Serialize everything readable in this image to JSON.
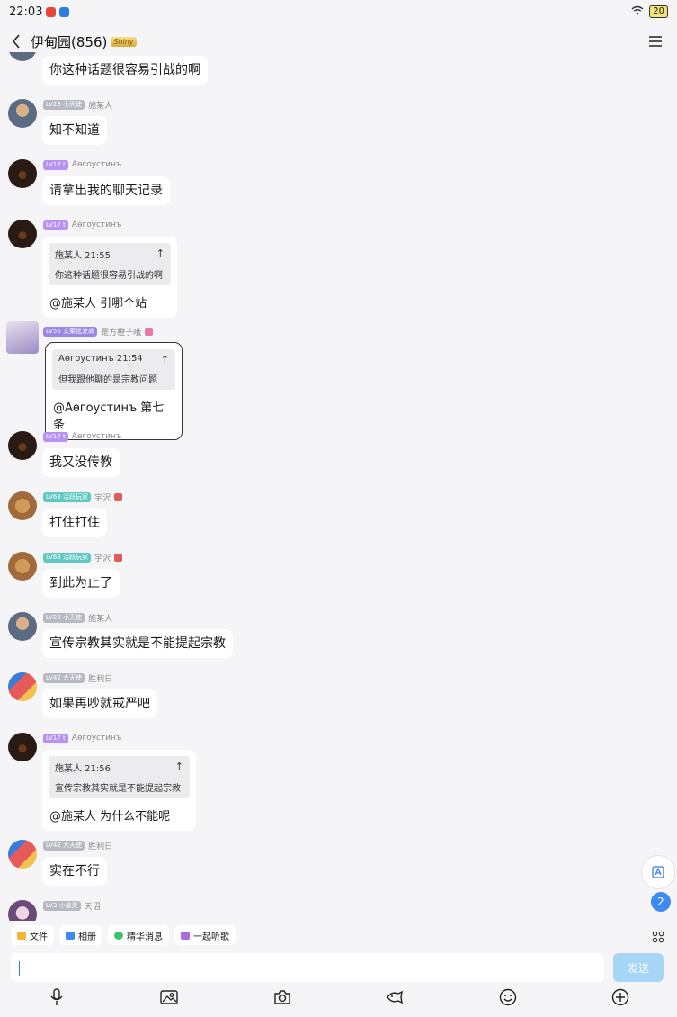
{
  "status_bar": {
    "time": "22:03",
    "battery": "20"
  },
  "header": {
    "title": "伊甸园(856)",
    "badge": "Shiny"
  },
  "messages": [
    {
      "text": "你这种话题很容易引战的啊"
    },
    {
      "level": "LV23 小天使",
      "name": "施某人",
      "text": "知不知道"
    },
    {
      "level": "LV17 t",
      "name": "Аөгоустинъ",
      "text": "请拿出我的聊天记录"
    },
    {
      "level": "LV17 t",
      "name": "Аөгоустинъ",
      "quote_head": "施某人 21:55",
      "quote_text": "你这种话题很容易引战的啊",
      "reply": "@施某人 引哪个站"
    },
    {
      "level": "LV55 文案批发商",
      "name": "是方橙子哦",
      "quote_head": "Аөгоустинъ 21:54",
      "quote_text": "但我跟他聊的是宗教问题",
      "reply": "@Аөгоустинъ 第七条"
    },
    {
      "level": "LV17 t",
      "name": "Аөгоустинъ",
      "text": "我又没传教"
    },
    {
      "level": "LV63 活跃玩家",
      "name": "宇沢",
      "text": "打住打住"
    },
    {
      "level": "LV63 活跃玩家",
      "name": "宇沢",
      "text": "到此为止了"
    },
    {
      "level": "LV23 小天使",
      "name": "施某人",
      "text": "宣传宗教其实就是不能提起宗教"
    },
    {
      "level": "LV42 大天使",
      "name": "胜利日",
      "text": "如果再吵就戒严吧"
    },
    {
      "level": "LV17 t",
      "name": "Аөгоустинъ",
      "quote_head": "施某人 21:56",
      "quote_text": "宣传宗教其实就是不能提起宗教",
      "reply": "@施某人 为什么不能呢"
    },
    {
      "level": "LV42 大天使",
      "name": "胜利日",
      "text": "实在不行"
    },
    {
      "level": "LV3 小星灵",
      "name": "天诏"
    }
  ],
  "unread_count": "2",
  "toolbar": {
    "chips": [
      "文件",
      "相册",
      "精华消息",
      "一起听歌"
    ],
    "input_value": "",
    "send_label": "发送"
  }
}
